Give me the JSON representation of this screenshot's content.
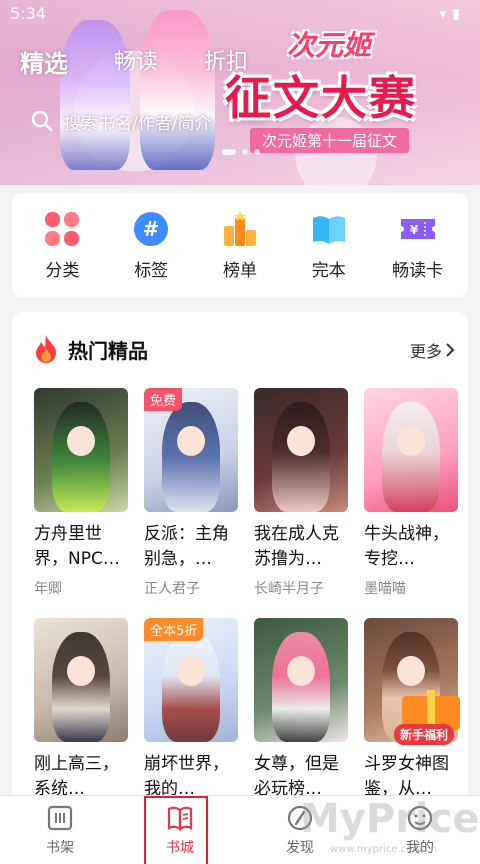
{
  "status": {
    "time": "5:34"
  },
  "banner": {
    "tabs": [
      "精选",
      "畅读",
      "折扣"
    ],
    "search_placeholder": "搜索书名/作者/简介",
    "promo_title_small": "次元姬",
    "promo_title_large": "征文大赛",
    "promo_subtitle": "次元姬第十一届征文"
  },
  "categories": [
    {
      "label": "分类",
      "icon": "clover-icon",
      "color": "#ff5d6c"
    },
    {
      "label": "标签",
      "icon": "hashtag-icon",
      "color": "#3d8bff"
    },
    {
      "label": "榜单",
      "icon": "trophy-icon",
      "color": "#ff8c1a"
    },
    {
      "label": "完本",
      "icon": "open-book-icon",
      "color": "#35b6f5"
    },
    {
      "label": "畅读卡",
      "icon": "ticket-icon",
      "color": "#8b5cf6"
    }
  ],
  "hot": {
    "title": "热门精品",
    "more": "更多",
    "books": [
      {
        "title": "方舟里世界，NPC…",
        "author": "年卿",
        "tag": ""
      },
      {
        "title": "反派：主角别急，…",
        "author": "正人君子",
        "tag": "免费"
      },
      {
        "title": "我在成人克苏撸为…",
        "author": "长崎半月子",
        "tag": ""
      },
      {
        "title": "牛头战神，专挖…",
        "author": "墨喵喵",
        "tag": ""
      },
      {
        "title": "刚上高三，系统…",
        "author": "",
        "tag": ""
      },
      {
        "title": "崩坏世界，我的…",
        "author": "",
        "tag": "全本5折"
      },
      {
        "title": "女尊，但是必玩榜…",
        "author": "",
        "tag": ""
      },
      {
        "title": "斗罗女神图鉴，从…",
        "author": "",
        "tag": ""
      }
    ],
    "gift_label": "新手福利"
  },
  "nav": [
    {
      "label": "书架",
      "icon": "bookshelf-icon"
    },
    {
      "label": "书城",
      "icon": "bookstore-icon"
    },
    {
      "label": "发现",
      "icon": "discover-icon"
    },
    {
      "label": "我的",
      "icon": "profile-icon"
    }
  ],
  "watermark": {
    "text": "MyPrice",
    "sub": "www.myprice.com.cn"
  }
}
